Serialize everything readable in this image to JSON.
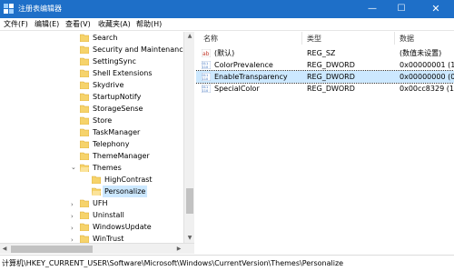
{
  "window": {
    "title": "注册表编辑器",
    "minimize_glyph": "—",
    "maximize_glyph": "☐",
    "close_glyph": "✕",
    "title_bar_color": "#1e6fc8"
  },
  "menu": [
    "文件(F)",
    "编辑(E)",
    "查看(V)",
    "收藏夹(A)",
    "帮助(H)"
  ],
  "tree": {
    "items": [
      {
        "label": "Search"
      },
      {
        "label": "Security and Maintenance"
      },
      {
        "label": "SettingSync"
      },
      {
        "label": "Shell Extensions"
      },
      {
        "label": "Skydrive"
      },
      {
        "label": "StartupNotify"
      },
      {
        "label": "StorageSense"
      },
      {
        "label": "Store"
      },
      {
        "label": "TaskManager"
      },
      {
        "label": "Telephony"
      },
      {
        "label": "ThemeManager"
      },
      {
        "label": "Themes"
      },
      {
        "label": "HighContrast"
      },
      {
        "label": "Personalize"
      },
      {
        "label": "UFH"
      },
      {
        "label": "Uninstall"
      },
      {
        "label": "WindowsUpdate"
      },
      {
        "label": "WinTrust"
      }
    ],
    "selected": "Personalize"
  },
  "values": {
    "headers": {
      "name": "名称",
      "type": "类型",
      "data": "数据"
    },
    "rows": [
      {
        "name": "(默认)",
        "type": "REG_SZ",
        "data": "(数值未设置)",
        "icon": "ab-string-icon"
      },
      {
        "name": "ColorPrevalence",
        "type": "REG_DWORD",
        "data": "0x00000001 (1)",
        "icon": "binary-value-icon"
      },
      {
        "name": "EnableTransparency",
        "type": "REG_DWORD",
        "data": "0x00000000 (0)",
        "icon": "binary-value-icon"
      },
      {
        "name": "SpecialColor",
        "type": "REG_DWORD",
        "data": "0x00cc8329 (13",
        "icon": "binary-value-icon"
      }
    ],
    "selected_row": "EnableTransparency"
  },
  "status": {
    "path": "计算机\\HKEY_CURRENT_USER\\Software\\Microsoft\\Windows\\CurrentVersion\\Themes\\Personalize"
  }
}
